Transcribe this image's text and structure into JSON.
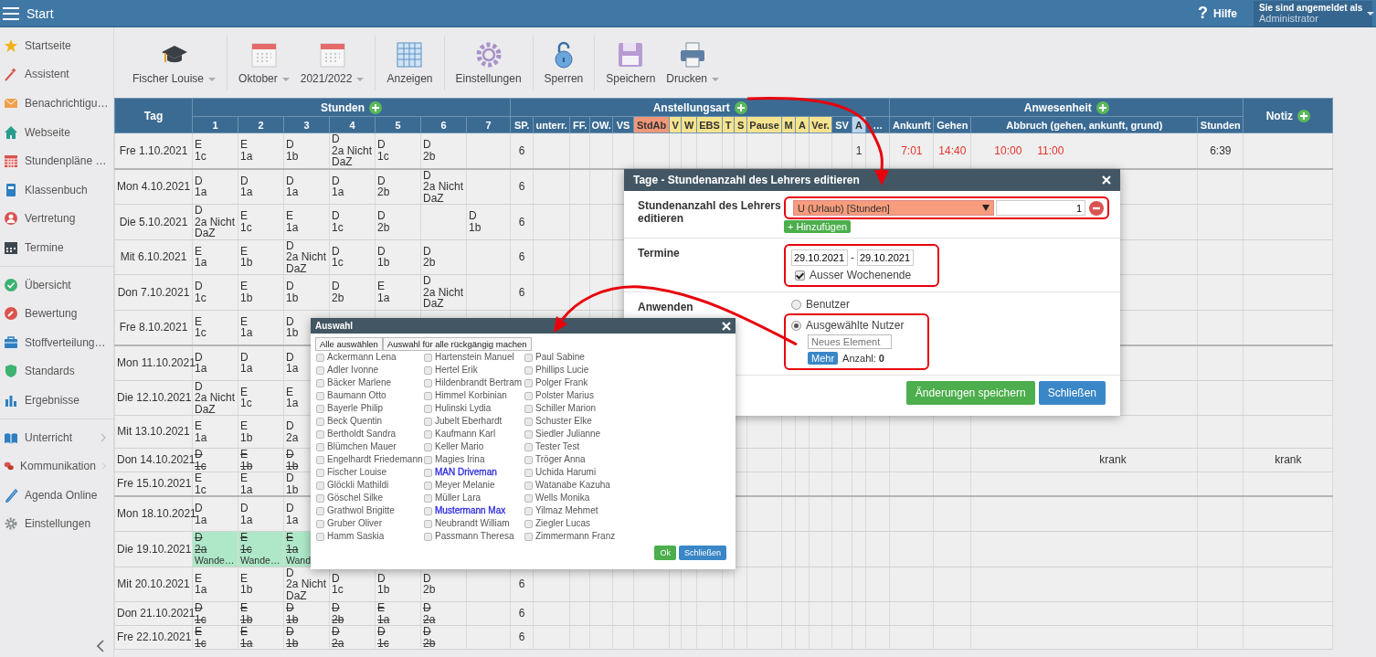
{
  "topbar": {
    "title": "Start",
    "help": {
      "icon": "?",
      "label": "Hilfe"
    },
    "user": {
      "caption": "Sie sind angemeldet als",
      "name": "Administrator"
    }
  },
  "sidebar": {
    "groups": [
      {
        "items": [
          {
            "label": "Startseite",
            "has_submenu": false
          },
          {
            "label": "Assistent",
            "has_submenu": false
          },
          {
            "label": "Benachrichtigu…",
            "has_submenu": false
          },
          {
            "label": "Webseite",
            "has_submenu": false
          },
          {
            "label": "Stundenpläne …",
            "has_submenu": false
          },
          {
            "label": "Klassenbuch",
            "has_submenu": false
          },
          {
            "label": "Vertretung",
            "has_submenu": false
          },
          {
            "label": "Termine",
            "has_submenu": false
          }
        ]
      },
      {
        "items": [
          {
            "label": "Übersicht",
            "has_submenu": false
          },
          {
            "label": "Bewertung",
            "has_submenu": false
          },
          {
            "label": "Stoffverteilung…",
            "has_submenu": false
          },
          {
            "label": "Standards",
            "has_submenu": false
          },
          {
            "label": "Ergebnisse",
            "has_submenu": false
          }
        ]
      },
      {
        "items": [
          {
            "label": "Unterricht",
            "has_submenu": true
          },
          {
            "label": "Kommunikation",
            "has_submenu": true
          },
          {
            "label": "Agenda Online",
            "has_submenu": false
          },
          {
            "label": "Einstellungen",
            "has_submenu": false
          }
        ]
      }
    ]
  },
  "toolbar": {
    "groups": [
      {
        "items": [
          {
            "label": "Fischer Louise",
            "dropdown": true
          }
        ]
      },
      {
        "items": [
          {
            "label": "Oktober",
            "dropdown": true
          },
          {
            "label": "2021/2022",
            "dropdown": true
          }
        ]
      },
      {
        "items": [
          {
            "label": "Anzeigen",
            "dropdown": false
          }
        ]
      },
      {
        "items": [
          {
            "label": "Einstellungen",
            "dropdown": false
          }
        ]
      },
      {
        "items": [
          {
            "label": "Sperren",
            "dropdown": false
          }
        ]
      },
      {
        "items": [
          {
            "label": "Speichern",
            "dropdown": false
          },
          {
            "label": "Drucken",
            "dropdown": true
          }
        ]
      }
    ]
  },
  "table": {
    "day_column": "Tag",
    "note_column": "Notiz",
    "groups": [
      {
        "title": "Stunden",
        "columns": [
          {
            "label": "1"
          },
          {
            "label": "2"
          },
          {
            "label": "3"
          },
          {
            "label": "4"
          },
          {
            "label": "5"
          },
          {
            "label": "6"
          },
          {
            "label": "7"
          }
        ]
      },
      {
        "title": "Anstellungsart",
        "columns": [
          {
            "label": "SP."
          },
          {
            "label": "unterr."
          },
          {
            "label": "FF."
          },
          {
            "label": "OW."
          },
          {
            "label": "VS"
          },
          {
            "label": "StdAb",
            "color": "#f0977a"
          },
          {
            "label": "V",
            "color": "#f5e38e"
          },
          {
            "label": "W",
            "color": "#f5e38e"
          },
          {
            "label": "EBS",
            "color": "#f5e38e"
          },
          {
            "label": "T",
            "color": "#f5e38e"
          },
          {
            "label": "S",
            "color": "#f5e38e"
          },
          {
            "label": "Pause",
            "color": "#f5e38e"
          },
          {
            "label": "M",
            "color": "#f5e38e"
          },
          {
            "label": "A",
            "color": "#f5e38e"
          },
          {
            "label": "Ver.",
            "color": "#f5e38e"
          },
          {
            "label": "SV"
          },
          {
            "label": "A",
            "color": "#bcd5ec"
          },
          {
            "label": "…"
          }
        ]
      },
      {
        "title": "Anwesenheit",
        "columns": [
          {
            "label": "Ankunft"
          },
          {
            "label": "Gehen"
          },
          {
            "label": "Abbruch (gehen, ankunft, grund)"
          },
          {
            "label": "Stunden"
          }
        ]
      }
    ],
    "rows": [
      {
        "day": "Fre 1.10.2021",
        "week_start": false,
        "lessons": [
          {
            "kind": "lesson",
            "subject": "E",
            "group": "1c",
            "cancelled": false,
            "highlighted": false
          },
          {
            "kind": "lesson",
            "subject": "E",
            "group": "1a",
            "cancelled": false,
            "highlighted": false
          },
          {
            "kind": "lesson",
            "subject": "D",
            "group": "1b",
            "cancelled": false,
            "highlighted": false
          },
          {
            "kind": "lesson",
            "subject": "D",
            "group": "2a Nicht DaZ",
            "cancelled": false,
            "highlighted": false
          },
          {
            "kind": "lesson",
            "subject": "D",
            "group": "1c",
            "cancelled": false,
            "highlighted": false
          },
          {
            "kind": "lesson",
            "subject": "D",
            "group": "2b",
            "cancelled": false,
            "highlighted": false
          }
        ],
        "sp": "6",
        "a_second": "1",
        "ankunft": "7:01",
        "gehen": "14:40",
        "abbruch": {
          "gehen": "10:00",
          "ankunft": "11:00"
        },
        "stunden": "6:39"
      },
      {
        "day": "Mon 4.10.2021",
        "week_start": true,
        "lessons": [
          {
            "kind": "lesson",
            "subject": "D",
            "group": "1a",
            "cancelled": false,
            "highlighted": false
          },
          {
            "kind": "lesson",
            "subject": "D",
            "group": "1a",
            "cancelled": false,
            "highlighted": false
          },
          {
            "kind": "lesson",
            "subject": "D",
            "group": "1a",
            "cancelled": false,
            "highlighted": false
          },
          {
            "kind": "lesson",
            "subject": "D",
            "group": "1a",
            "cancelled": false,
            "highlighted": false
          },
          {
            "kind": "lesson",
            "subject": "D",
            "group": "2b",
            "cancelled": false,
            "highlighted": false
          },
          {
            "kind": "lesson",
            "subject": "D",
            "group": "2a Nicht DaZ",
            "cancelled": false,
            "highlighted": false
          }
        ],
        "sp": "6"
      },
      {
        "day": "Die 5.10.2021",
        "week_start": false,
        "lessons": [
          {
            "kind": "lesson",
            "subject": "D",
            "group": "2a Nicht DaZ",
            "cancelled": false,
            "highlighted": false
          },
          {
            "kind": "lesson",
            "subject": "E",
            "group": "1c",
            "cancelled": false,
            "highlighted": false
          },
          {
            "kind": "lesson",
            "subject": "E",
            "group": "1a",
            "cancelled": false,
            "highlighted": false
          },
          {
            "kind": "lesson",
            "subject": "D",
            "group": "1c",
            "cancelled": false,
            "highlighted": false
          },
          {
            "kind": "lesson",
            "subject": "D",
            "group": "2b",
            "cancelled": false,
            "highlighted": false
          },
          {
            "kind": "free"
          },
          {
            "kind": "lesson",
            "subject": "D",
            "group": "1b",
            "cancelled": false,
            "highlighted": false
          }
        ],
        "sp": "6"
      },
      {
        "day": "Mit 6.10.2021",
        "week_start": false,
        "lessons": [
          {
            "kind": "lesson",
            "subject": "E",
            "group": "1a",
            "cancelled": false,
            "highlighted": false
          },
          {
            "kind": "lesson",
            "subject": "E",
            "group": "1b",
            "cancelled": false,
            "highlighted": false
          },
          {
            "kind": "lesson",
            "subject": "D",
            "group": "2a Nicht DaZ",
            "cancelled": false,
            "highlighted": false
          },
          {
            "kind": "lesson",
            "subject": "D",
            "group": "1c",
            "cancelled": false,
            "highlighted": false
          },
          {
            "kind": "lesson",
            "subject": "D",
            "group": "1b",
            "cancelled": false,
            "highlighted": false
          },
          {
            "kind": "lesson",
            "subject": "D",
            "group": "2b",
            "cancelled": false,
            "highlighted": false
          }
        ],
        "sp": "6"
      },
      {
        "day": "Don 7.10.2021",
        "week_start": false,
        "lessons": [
          {
            "kind": "lesson",
            "subject": "D",
            "group": "1c",
            "cancelled": false,
            "highlighted": false
          },
          {
            "kind": "lesson",
            "subject": "E",
            "group": "1b",
            "cancelled": false,
            "highlighted": false
          },
          {
            "kind": "lesson",
            "subject": "D",
            "group": "1b",
            "cancelled": false,
            "highlighted": false
          },
          {
            "kind": "lesson",
            "subject": "D",
            "group": "2b",
            "cancelled": false,
            "highlighted": false
          },
          {
            "kind": "lesson",
            "subject": "E",
            "group": "1a",
            "cancelled": false,
            "highlighted": false
          },
          {
            "kind": "lesson",
            "subject": "D",
            "group": "2a Nicht DaZ",
            "cancelled": false,
            "highlighted": false
          }
        ],
        "sp": "6"
      },
      {
        "day": "Fre 8.10.2021",
        "week_start": false,
        "lessons": [
          {
            "kind": "lesson",
            "subject": "E",
            "group": "1c",
            "cancelled": false,
            "highlighted": false
          },
          {
            "kind": "lesson",
            "subject": "E",
            "group": "1a",
            "cancelled": false,
            "highlighted": false
          },
          {
            "kind": "lesson",
            "subject": "D",
            "group": "1b",
            "cancelled": false,
            "highlighted": false
          }
        ]
      },
      {
        "day": "Mon 11.10.2021",
        "week_start": true,
        "lessons": [
          {
            "kind": "lesson",
            "subject": "D",
            "group": "1a",
            "cancelled": false,
            "highlighted": false
          },
          {
            "kind": "lesson",
            "subject": "D",
            "group": "1a",
            "cancelled": false,
            "highlighted": false
          },
          {
            "kind": "lesson",
            "subject": "D",
            "group": "1a",
            "cancelled": false,
            "highlighted": false
          }
        ]
      },
      {
        "day": "Die 12.10.2021",
        "week_start": false,
        "lessons": [
          {
            "kind": "lesson",
            "subject": "D",
            "group": "2a Nicht DaZ",
            "cancelled": false,
            "highlighted": false
          },
          {
            "kind": "lesson",
            "subject": "E",
            "group": "1c",
            "cancelled": false,
            "highlighted": false
          },
          {
            "kind": "lesson",
            "subject": "E",
            "group": "1a",
            "cancelled": false,
            "highlighted": false
          }
        ]
      },
      {
        "day": "Mit 13.10.2021",
        "week_start": false,
        "lessons": [
          {
            "kind": "lesson",
            "subject": "E",
            "group": "1a",
            "cancelled": false,
            "highlighted": false
          },
          {
            "kind": "lesson",
            "subject": "E",
            "group": "1b",
            "cancelled": false,
            "highlighted": false
          },
          {
            "kind": "lesson",
            "subject": "D",
            "group": "2a",
            "cancelled": false,
            "highlighted": false
          }
        ]
      },
      {
        "day": "Don 14.10.2021",
        "week_start": false,
        "lessons": [
          {
            "kind": "lesson",
            "subject": "D",
            "group": "1c",
            "cancelled": true,
            "highlighted": false
          },
          {
            "kind": "lesson",
            "subject": "E",
            "group": "1b",
            "cancelled": true,
            "highlighted": false
          },
          {
            "kind": "lesson",
            "subject": "D",
            "group": "1b",
            "cancelled": true,
            "highlighted": false
          }
        ],
        "abbruch": {
          "grund": "krank"
        },
        "note": "krank"
      },
      {
        "day": "Fre 15.10.2021",
        "week_start": false,
        "lessons": [
          {
            "kind": "lesson",
            "subject": "E",
            "group": "1c",
            "cancelled": false,
            "highlighted": false
          },
          {
            "kind": "lesson",
            "subject": "E",
            "group": "1a",
            "cancelled": false,
            "highlighted": false
          },
          {
            "kind": "lesson",
            "subject": "D",
            "group": "1b",
            "cancelled": false,
            "highlighted": false
          }
        ]
      },
      {
        "day": "Mon 18.10.2021",
        "week_start": true,
        "lessons": [
          {
            "kind": "lesson",
            "subject": "D",
            "group": "1a",
            "cancelled": false,
            "highlighted": false
          },
          {
            "kind": "lesson",
            "subject": "D",
            "group": "1a",
            "cancelled": false,
            "highlighted": false
          },
          {
            "kind": "lesson",
            "subject": "D",
            "group": "1a",
            "cancelled": false,
            "highlighted": false
          }
        ]
      },
      {
        "day": "Die 19.10.2021",
        "week_start": false,
        "lessons": [
          {
            "kind": "lesson",
            "subject": "D",
            "group": "2a",
            "note": "Wande…",
            "cancelled": true,
            "highlighted": true
          },
          {
            "kind": "lesson",
            "subject": "E",
            "group": "1c",
            "note": "Wande…",
            "cancelled": true,
            "highlighted": true
          },
          {
            "kind": "lesson",
            "subject": "E",
            "group": "1a",
            "note": "Wand",
            "cancelled": true,
            "highlighted": true
          }
        ]
      },
      {
        "day": "Mit 20.10.2021",
        "week_start": false,
        "lessons": [
          {
            "kind": "lesson",
            "subject": "E",
            "group": "1a",
            "cancelled": false,
            "highlighted": false
          },
          {
            "kind": "lesson",
            "subject": "E",
            "group": "1b",
            "cancelled": false,
            "highlighted": false
          },
          {
            "kind": "lesson",
            "subject": "D",
            "group": "2a Nicht DaZ",
            "cancelled": false,
            "highlighted": false
          },
          {
            "kind": "lesson",
            "subject": "D",
            "group": "1c",
            "cancelled": false,
            "highlighted": false
          },
          {
            "kind": "lesson",
            "subject": "D",
            "group": "1b",
            "cancelled": false,
            "highlighted": false
          },
          {
            "kind": "lesson",
            "subject": "D",
            "group": "2b",
            "cancelled": false,
            "highlighted": false
          }
        ],
        "sp": "6"
      },
      {
        "day": "Don 21.10.2021",
        "week_start": false,
        "lessons": [
          {
            "kind": "lesson",
            "subject": "D",
            "group": "1c",
            "cancelled": true,
            "highlighted": false
          },
          {
            "kind": "lesson",
            "subject": "E",
            "group": "1b",
            "cancelled": true,
            "highlighted": false
          },
          {
            "kind": "lesson",
            "subject": "D",
            "group": "1b",
            "cancelled": true,
            "highlighted": false
          },
          {
            "kind": "lesson",
            "subject": "D",
            "group": "2b",
            "cancelled": true,
            "highlighted": false
          },
          {
            "kind": "lesson",
            "subject": "E",
            "group": "1a",
            "cancelled": true,
            "highlighted": false
          },
          {
            "kind": "lesson",
            "subject": "D",
            "group": "2a",
            "cancelled": true,
            "highlighted": false
          }
        ],
        "sp": "6"
      },
      {
        "day": "Fre 22.10.2021",
        "week_start": false,
        "lessons": [
          {
            "kind": "lesson",
            "subject": "E",
            "group": "1c",
            "cancelled": true,
            "highlighted": false
          },
          {
            "kind": "lesson",
            "subject": "E",
            "group": "1a",
            "cancelled": true,
            "highlighted": false
          },
          {
            "kind": "lesson",
            "subject": "D",
            "group": "1b",
            "cancelled": true,
            "highlighted": false
          },
          {
            "kind": "lesson",
            "subject": "D",
            "group": "2a",
            "cancelled": true,
            "highlighted": false
          },
          {
            "kind": "lesson",
            "subject": "D",
            "group": "1c",
            "cancelled": true,
            "highlighted": false
          },
          {
            "kind": "lesson",
            "subject": "D",
            "group": "2b",
            "cancelled": true,
            "highlighted": false
          }
        ],
        "sp": "6"
      }
    ]
  },
  "edit_dialog": {
    "title": "Tage - Stundenanzahl des Lehrers editieren",
    "hours": {
      "label": "Stundenanzahl des Lehrers editieren",
      "type": "U (Urlaub) [Stunden]",
      "amount": "1",
      "add_button": "+ Hinzufügen"
    },
    "dates": {
      "label": "Termine",
      "from": "29.10.2021",
      "separator": "-",
      "to": "29.10.2021",
      "exclude_weekend": {
        "label": "Ausser Wochenende",
        "checked": true
      }
    },
    "apply": {
      "label": "Anwenden",
      "options": [
        {
          "label": "Benutzer",
          "selected": false
        },
        {
          "label": "Ausgewählte Nutzer",
          "selected": true
        }
      ],
      "new_item": {
        "placeholder": "Neues Element"
      },
      "more_button": "Mehr",
      "count": "Anzahl: **0**"
    },
    "buttons": [
      {
        "label": "Änderungen speichern",
        "kind": "confirm"
      },
      {
        "label": "Schließen",
        "kind": "close"
      }
    ]
  },
  "selection_dialog": {
    "title": "Auswahl",
    "actions": [
      "Alle auswählen",
      "Auswahl für alle rückgängig machen"
    ],
    "users": [
      {
        "name": "Ackermann Lena",
        "checked": false
      },
      {
        "name": "Adler Ivonne",
        "checked": false
      },
      {
        "name": "Bäcker Marlene",
        "checked": false
      },
      {
        "name": "Baumann Otto",
        "checked": false
      },
      {
        "name": "Bayerle Philip",
        "checked": false
      },
      {
        "name": "Beck Quentin",
        "checked": false
      },
      {
        "name": "Bertholdt Sandra",
        "checked": false
      },
      {
        "name": "Blümchen Mauer",
        "checked": false
      },
      {
        "name": "Engelhardt Friedemann",
        "checked": false
      },
      {
        "name": "Fischer Louise",
        "checked": false
      },
      {
        "name": "Glöckli Mathildi",
        "checked": false
      },
      {
        "name": "Göschel Silke",
        "checked": false
      },
      {
        "name": "Grathwol Brigitte",
        "checked": false
      },
      {
        "name": "Gruber Oliver",
        "checked": false
      },
      {
        "name": "Hamm Saskia",
        "checked": false
      },
      {
        "name": "Hartenstein Manuel",
        "checked": false
      },
      {
        "name": "Hertel Erik",
        "checked": false
      },
      {
        "name": "Hildenbrandt Bertram",
        "checked": false
      },
      {
        "name": "Himmel Korbinian",
        "checked": false
      },
      {
        "name": "Hulinski Lydia",
        "checked": false
      },
      {
        "name": "Jubelt Eberhardt",
        "checked": false
      },
      {
        "name": "Kaufmann Karl",
        "checked": false
      },
      {
        "name": "Keller Mario",
        "checked": false
      },
      {
        "name": "Magies Irina",
        "checked": false
      },
      {
        "name": "MAN Driveman",
        "checked": false,
        "color": "#2a2ae0"
      },
      {
        "name": "Meyer Melanie",
        "checked": false
      },
      {
        "name": "Müller Lara",
        "checked": false
      },
      {
        "name": "Mustermann Max",
        "checked": false,
        "color": "#2a2ae0"
      },
      {
        "name": "Neubrandt William",
        "checked": false
      },
      {
        "name": "Passmann Theresa",
        "checked": false
      },
      {
        "name": "Paul Sabine",
        "checked": false
      },
      {
        "name": "Phillips Lucie",
        "checked": false
      },
      {
        "name": "Polger Frank",
        "checked": false
      },
      {
        "name": "Polster Marius",
        "checked": false
      },
      {
        "name": "Schiller Marion",
        "checked": false
      },
      {
        "name": "Schuster Elke",
        "checked": false
      },
      {
        "name": "Siedler Julianne",
        "checked": false
      },
      {
        "name": "Tester Test",
        "checked": false
      },
      {
        "name": "Tröger Anna",
        "checked": false
      },
      {
        "name": "Uchida Harumi",
        "checked": false
      },
      {
        "name": "Watanabe Kazuha",
        "checked": false
      },
      {
        "name": "Wells Monika",
        "checked": false
      },
      {
        "name": "Yilmaz Mehmet",
        "checked": false
      },
      {
        "name": "Ziegler Lucas",
        "checked": false
      },
      {
        "name": "Zimmermann Franz",
        "checked": false
      }
    ],
    "buttons": [
      {
        "label": "Ok",
        "kind": "confirm"
      },
      {
        "label": "Schließen",
        "kind": "close"
      }
    ]
  }
}
